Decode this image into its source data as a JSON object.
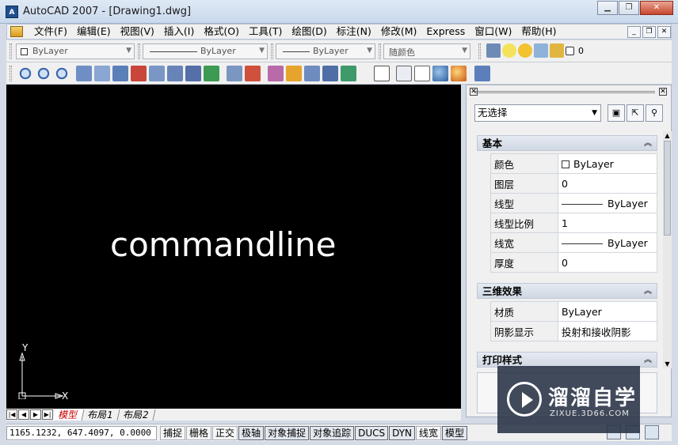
{
  "window": {
    "title": "AutoCAD 2007 - [Drawing1.dwg]",
    "app_icon": "autocad-icon",
    "controls": [
      "minimize-icon",
      "restore-icon",
      "close-icon"
    ]
  },
  "menu": {
    "items": [
      "文件(F)",
      "编辑(E)",
      "视图(V)",
      "插入(I)",
      "格式(O)",
      "工具(T)",
      "绘图(D)",
      "标注(N)",
      "修改(M)",
      "Express",
      "窗口(W)",
      "帮助(H)"
    ]
  },
  "toolbar1": {
    "color_value": "ByLayer",
    "linetype_value": "ByLayer",
    "lineweight_value": "ByLayer",
    "plotstyle_value": "随颜色",
    "layer_value": "0"
  },
  "canvas": {
    "overlay_text": "commandline",
    "ucs_x": "X",
    "ucs_y": "Y"
  },
  "tabs": {
    "items": [
      "模型",
      "布局1",
      "布局2"
    ],
    "active": "模型"
  },
  "status": {
    "coordinates": "1165.1232,  647.4097,  0.0000",
    "buttons": [
      "捕捉",
      "栅格",
      "正交",
      "极轴",
      "对象捕捉",
      "对象追踪",
      "DUCS",
      "DYN",
      "线宽",
      "模型"
    ]
  },
  "properties": {
    "selection": "无选择",
    "sections": {
      "basic": {
        "title": "基本",
        "rows": [
          {
            "key": "颜色",
            "value": "ByLayer"
          },
          {
            "key": "图层",
            "value": "0"
          },
          {
            "key": "线型",
            "value": "ByLayer"
          },
          {
            "key": "线型比例",
            "value": "1"
          },
          {
            "key": "线宽",
            "value": "ByLayer"
          },
          {
            "key": "厚度",
            "value": "0"
          }
        ]
      },
      "3d": {
        "title": "三维效果",
        "rows": [
          {
            "key": "材质",
            "value": "ByLayer"
          },
          {
            "key": "阴影显示",
            "value": "投射和接收阴影"
          }
        ]
      },
      "plot": {
        "title": "打印样式"
      }
    }
  },
  "watermark": {
    "title": "溜溜自学",
    "subtitle": "ZIXUE.3D66.COM"
  }
}
